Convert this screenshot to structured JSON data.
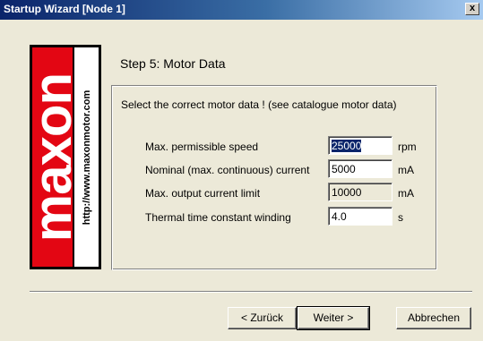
{
  "window": {
    "title": "Startup Wizard  [Node 1]",
    "close_label": "x"
  },
  "logo": {
    "brand": "maxon",
    "url": "http://www.maxonmotor.com"
  },
  "step_title": "Step 5: Motor Data",
  "instruction": "Select the correct motor data ! (see catalogue motor data)",
  "fields": [
    {
      "label": "Max. permissible speed",
      "value": "25000",
      "unit": "rpm",
      "editable": true,
      "selected": true
    },
    {
      "label": "Nominal (max. continuous) current",
      "value": "5000",
      "unit": "mA",
      "editable": true,
      "selected": false
    },
    {
      "label": "Max. output current limit",
      "value": "10000",
      "unit": "mA",
      "editable": false,
      "selected": false
    },
    {
      "label": "Thermal time constant winding",
      "value": "4.0",
      "unit": "s",
      "editable": true,
      "selected": false
    }
  ],
  "buttons": {
    "back": "< Zurück",
    "next": "Weiter >",
    "cancel": "Abbrechen"
  }
}
